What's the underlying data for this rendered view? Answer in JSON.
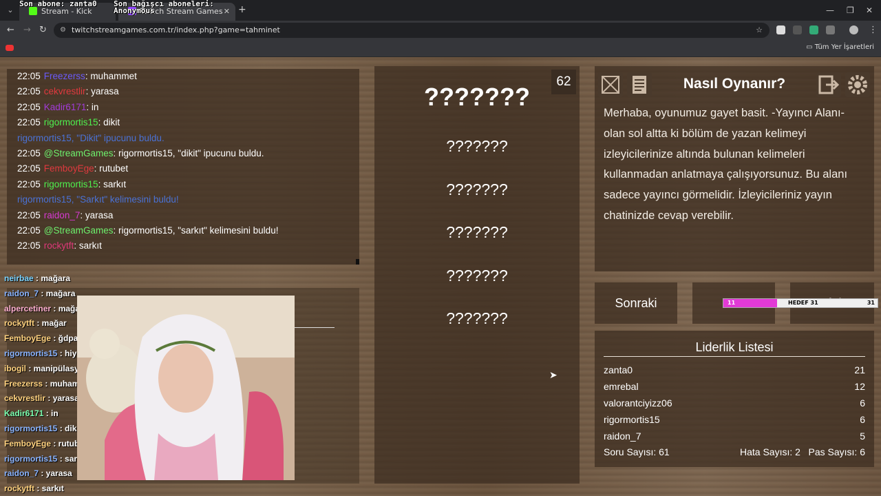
{
  "browser": {
    "overlay_left": "Son abone: zanta0",
    "overlay_right": "Son bağışcı aboneleri:",
    "tabs": [
      {
        "title": "Stream - Kick Dashboard",
        "favicon_color": "#53fc18"
      },
      {
        "title": "Twitch Stream Games",
        "overlay": "Anonymous"
      }
    ],
    "url": "twitchstreamgames.com.tr/index.php?game=tahminet",
    "bookmarks_all": "Tüm Yer İşaretleri"
  },
  "chat": [
    {
      "time": "22:05",
      "user": "Freezerss",
      "color": "#6a5af9",
      "msg": ": muhammet"
    },
    {
      "time": "22:05",
      "user": "cekvrestlir",
      "color": "#e0393e",
      "msg": ": yarasa"
    },
    {
      "time": "22:05",
      "user": "Kadir6171",
      "color": "#a23bd8",
      "msg": ": in"
    },
    {
      "time": "22:05",
      "user": "rigormortis15",
      "color": "#4ef04e",
      "msg": ": dikit"
    },
    {
      "time": "",
      "user": "rigormortis15,",
      "color": "#4a72d6",
      "msg": " \"Dikit\" ipucunu buldu.",
      "sys": true
    },
    {
      "time": "22:05",
      "user": "@StreamGames",
      "color": "#6df06d",
      "msg": ": rigormortis15, \"dikit\" ipucunu buldu."
    },
    {
      "time": "22:05",
      "user": "FemboyEge",
      "color": "#e0393e",
      "msg": ": rutubet"
    },
    {
      "time": "22:05",
      "user": "rigormortis15",
      "color": "#4ef04e",
      "msg": ": sarkıt"
    },
    {
      "time": "",
      "user": "rigormortis15,",
      "color": "#4a72d6",
      "msg": " \"Sarkıt\" kelimesini buldu!",
      "sys": true
    },
    {
      "time": "22:05",
      "user": "raidon_7",
      "color": "#d63ad0",
      "msg": ": yarasa"
    },
    {
      "time": "22:05",
      "user": "@StreamGames",
      "color": "#6df06d",
      "msg": ": rigormortis15, \"sarkıt\" kelimesini buldu!"
    },
    {
      "time": "22:05",
      "user": "rockytft",
      "color": "#e0397a",
      "msg": ": sarkıt"
    }
  ],
  "obs_chat": [
    {
      "user": "neirbae",
      "color": "#7cd4ff",
      "msg": " : mağara"
    },
    {
      "user": "raidon_7",
      "color": "#8ab4ff",
      "msg": " : mağara"
    },
    {
      "user": "alpercetiner",
      "color": "#ffb0d0",
      "msg": " : mağa"
    },
    {
      "user": "rockytft",
      "color": "#ffd27f",
      "msg": " : mağar"
    },
    {
      "user": "FemboyEge",
      "color": "#ffd27f",
      "msg": " : ğdpav"
    },
    {
      "user": "rigormortis15",
      "color": "#8ab4ff",
      "msg": " : hiye"
    },
    {
      "user": "ibogil",
      "color": "#ffd27f",
      "msg": " : manipülasyo"
    },
    {
      "user": "Freezerss",
      "color": "#ffd27f",
      "msg": " : muham"
    },
    {
      "user": "cekvrestlir",
      "color": "#ffd27f",
      "msg": " : yarasa"
    },
    {
      "user": "Kadir6171",
      "color": "#7cffb0",
      "msg": " : in"
    },
    {
      "user": "rigormortis15",
      "color": "#8ab4ff",
      "msg": " : diki"
    },
    {
      "user": "FemboyEge",
      "color": "#ffd27f",
      "msg": " : rutub"
    },
    {
      "user": "rigormortis15",
      "color": "#8ab4ff",
      "msg": " : sark"
    },
    {
      "user": "raidon_7",
      "color": "#8ab4ff",
      "msg": " : yarasa"
    },
    {
      "user": "rockytft",
      "color": "#ffd27f",
      "msg": " : sarkıt"
    }
  ],
  "game": {
    "main_word": "???????",
    "hint_words": [
      "???????",
      "???????",
      "???????",
      "???????",
      "???????"
    ],
    "timer": "62"
  },
  "how_to": {
    "title": "Nasıl Oynanır?",
    "text": "Merhaba, oyunumuz gayet basit. -Yayıncı Alanı- olan sol altta ki bölüm de yazan kelimeyi izleyicilerinize altında bulunan kelimeleri kullanmadan anlatmaya çalışıyorsunuz. Bu alanı sadece yayıncı görmelidir. İzleyicileriniz yayın chatinizde cevap verebilir."
  },
  "controls": {
    "next": "Sonraki",
    "reset": "Sıfırla",
    "goal_current": "11",
    "goal_label": "HEDEF 31",
    "goal_target": "31",
    "goal_progress": 0.35
  },
  "leaderboard": {
    "title": "Liderlik Listesi",
    "rows": [
      {
        "name": "zanta0",
        "score": "21"
      },
      {
        "name": "emrebal",
        "score": "12"
      },
      {
        "name": "valorantciyizz06",
        "score": "6"
      },
      {
        "name": "rigormortis15",
        "score": "6"
      },
      {
        "name": "raidon_7",
        "score": "5"
      }
    ],
    "question_count": "Soru Sayısı: 61",
    "error_count": "Hata Sayısı: 2",
    "pass_count": "Pas Sayısı: 6"
  }
}
